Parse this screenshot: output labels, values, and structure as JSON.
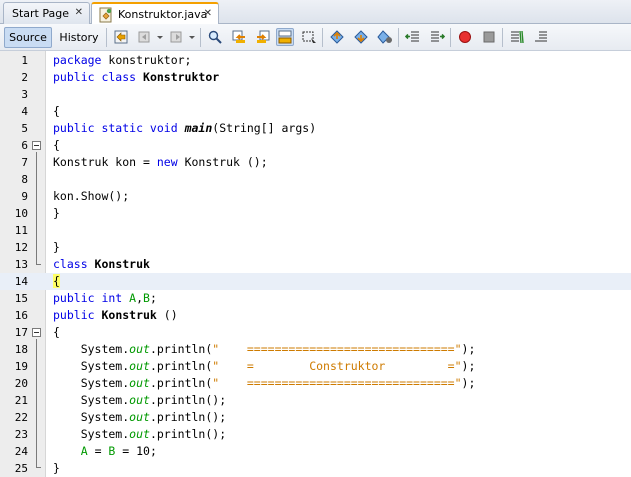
{
  "tabs": [
    {
      "label": "Start Page",
      "active": false
    },
    {
      "label": "Konstruktor.java",
      "active": true
    }
  ],
  "toolbar": {
    "source_label": "Source",
    "history_label": "History"
  },
  "editor": {
    "current_line": 14,
    "lines": [
      {
        "n": "1",
        "segs": [
          {
            "t": "package",
            "c": "kw"
          },
          {
            "t": " konstruktor;",
            "c": ""
          }
        ]
      },
      {
        "n": "2",
        "segs": [
          {
            "t": "public class ",
            "c": "kw"
          },
          {
            "t": "Konstruktor",
            "c": "bold"
          }
        ]
      },
      {
        "n": "3",
        "segs": []
      },
      {
        "n": "4",
        "segs": [
          {
            "t": "{",
            "c": ""
          }
        ]
      },
      {
        "n": "5",
        "segs": [
          {
            "t": "public static void ",
            "c": "kw"
          },
          {
            "t": "main",
            "c": "bi"
          },
          {
            "t": "(String[] args)",
            "c": ""
          }
        ]
      },
      {
        "n": "6",
        "segs": [
          {
            "t": "{",
            "c": ""
          }
        ]
      },
      {
        "n": "7",
        "segs": [
          {
            "t": "Konstruk kon = ",
            "c": ""
          },
          {
            "t": "new",
            "c": "kw"
          },
          {
            "t": " Konstruk ();",
            "c": ""
          }
        ]
      },
      {
        "n": "8",
        "segs": []
      },
      {
        "n": "9",
        "segs": [
          {
            "t": "kon.Show();",
            "c": ""
          }
        ]
      },
      {
        "n": "10",
        "segs": [
          {
            "t": "}",
            "c": ""
          }
        ]
      },
      {
        "n": "11",
        "segs": []
      },
      {
        "n": "12",
        "segs": [
          {
            "t": "}",
            "c": ""
          }
        ]
      },
      {
        "n": "13",
        "segs": [
          {
            "t": "class ",
            "c": "kw"
          },
          {
            "t": "Konstruk",
            "c": "bold"
          }
        ]
      },
      {
        "n": "14",
        "segs": [
          {
            "t": "{",
            "c": "brace-hl"
          }
        ]
      },
      {
        "n": "15",
        "segs": [
          {
            "t": "public int ",
            "c": "kw"
          },
          {
            "t": "A",
            "c": "green"
          },
          {
            "t": ",",
            "c": ""
          },
          {
            "t": "B",
            "c": "green"
          },
          {
            "t": ";",
            "c": ""
          }
        ]
      },
      {
        "n": "16",
        "segs": [
          {
            "t": "public ",
            "c": "kw"
          },
          {
            "t": "Konstruk",
            "c": "bold"
          },
          {
            "t": " ()",
            "c": ""
          }
        ]
      },
      {
        "n": "17",
        "segs": [
          {
            "t": "{",
            "c": ""
          }
        ]
      },
      {
        "n": "18",
        "segs": [
          {
            "t": "    System.",
            "c": ""
          },
          {
            "t": "out",
            "c": "field"
          },
          {
            "t": ".println(",
            "c": ""
          },
          {
            "t": "\"    ==============================\"",
            "c": "str"
          },
          {
            "t": ");",
            "c": ""
          }
        ]
      },
      {
        "n": "19",
        "segs": [
          {
            "t": "    System.",
            "c": ""
          },
          {
            "t": "out",
            "c": "field"
          },
          {
            "t": ".println(",
            "c": ""
          },
          {
            "t": "\"    =        Construktor         =\"",
            "c": "str"
          },
          {
            "t": ");",
            "c": ""
          }
        ]
      },
      {
        "n": "20",
        "segs": [
          {
            "t": "    System.",
            "c": ""
          },
          {
            "t": "out",
            "c": "field"
          },
          {
            "t": ".println(",
            "c": ""
          },
          {
            "t": "\"    ==============================\"",
            "c": "str"
          },
          {
            "t": ");",
            "c": ""
          }
        ]
      },
      {
        "n": "21",
        "segs": [
          {
            "t": "    System.",
            "c": ""
          },
          {
            "t": "out",
            "c": "field"
          },
          {
            "t": ".println();",
            "c": ""
          }
        ]
      },
      {
        "n": "22",
        "segs": [
          {
            "t": "    System.",
            "c": ""
          },
          {
            "t": "out",
            "c": "field"
          },
          {
            "t": ".println();",
            "c": ""
          }
        ]
      },
      {
        "n": "23",
        "segs": [
          {
            "t": "    System.",
            "c": ""
          },
          {
            "t": "out",
            "c": "field"
          },
          {
            "t": ".println();",
            "c": ""
          }
        ]
      },
      {
        "n": "24",
        "segs": [
          {
            "t": "    ",
            "c": ""
          },
          {
            "t": "A",
            "c": "green"
          },
          {
            "t": " = ",
            "c": ""
          },
          {
            "t": "B",
            "c": "green"
          },
          {
            "t": " = 10;",
            "c": ""
          }
        ]
      },
      {
        "n": "25",
        "segs": [
          {
            "t": "}",
            "c": ""
          }
        ]
      }
    ]
  }
}
